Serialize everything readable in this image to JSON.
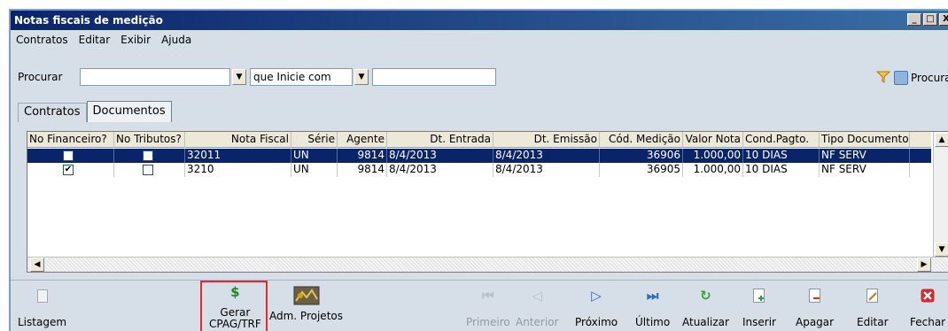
{
  "window": {
    "title": "Notas fiscais de medição",
    "controls": [
      "_",
      "□",
      "X"
    ]
  },
  "menu": [
    "Contratos",
    "Editar",
    "Exibir",
    "Ajuda"
  ],
  "search": {
    "label": "Procurar",
    "field_value": "",
    "mode_value": "que Inicie com",
    "text_value": "",
    "button_label": "Procurar"
  },
  "tabs": [
    {
      "label": "Contratos",
      "active": false
    },
    {
      "label": "Documentos",
      "active": true
    }
  ],
  "grid": {
    "columns": [
      "No Financeiro?",
      "No Tributos?",
      "Nota Fiscal",
      "Série",
      "Agente",
      "Dt. Entrada",
      "Dt. Emissão",
      "Cód. Medição",
      "Valor Nota",
      "Cond.Pagto.",
      "Tipo Documento"
    ],
    "rows": [
      {
        "financeiro": false,
        "tributos": false,
        "nota": "32011",
        "serie": "UN",
        "agente": "9814",
        "entrada": "8/4/2013",
        "emissao": "8/4/2013",
        "medicao": "36906",
        "valor": "1.000,00",
        "cond": "10 DIAS",
        "tipo": "NF SERV",
        "selected": true
      },
      {
        "financeiro": true,
        "tributos": false,
        "nota": "3210",
        "serie": "UN",
        "agente": "9814",
        "entrada": "8/4/2013",
        "emissao": "8/4/2013",
        "medicao": "36905",
        "valor": "1.000,00",
        "cond": "10 DIAS",
        "tipo": "NF SERV",
        "selected": false
      }
    ]
  },
  "toolbar": {
    "listagem": "Listagem",
    "gerar_line1": "Gerar",
    "gerar_line2": "CPAG/TRF",
    "adm": "Adm. Projetos",
    "primeiro": "Primeiro",
    "anterior": "Anterior",
    "proximo": "Próximo",
    "ultimo": "Último",
    "atualizar": "Atualizar",
    "inserir": "Inserir",
    "apagar": "Apagar",
    "editar": "Editar",
    "fechar": "Fechar"
  },
  "colors": {
    "selection": "#0a246a",
    "highlight_border": "#e8282a",
    "dollar": "#1a8a1a",
    "close": "#d9262a"
  }
}
